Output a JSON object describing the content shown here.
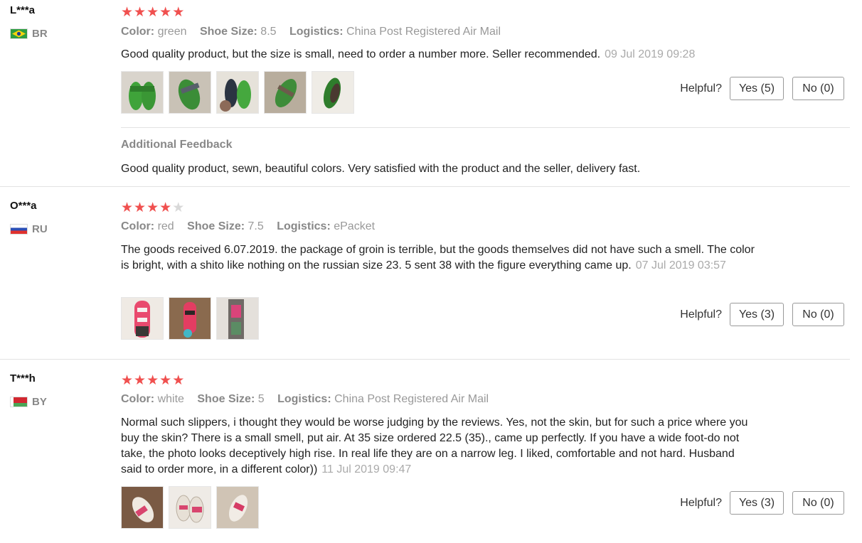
{
  "reviews": [
    {
      "user": "L***a",
      "country": "BR",
      "stars": [
        "★",
        "★",
        "★",
        "★",
        "★"
      ],
      "attrs": [
        {
          "label": "Color:",
          "value": "green"
        },
        {
          "label": "Shoe Size:",
          "value": "8.5"
        },
        {
          "label": "Logistics:",
          "value": "China Post Registered Air Mail"
        }
      ],
      "text": "Good quality product, but the size is small, need to order a number more. Seller recommended.",
      "date": "09 Jul 2019 09:28",
      "helpful_label": "Helpful?",
      "yes_label": "Yes (5)",
      "no_label": "No (0)",
      "additional_title": "Additional Feedback",
      "additional_text": "Good quality product, sewn, beautiful colors. Very satisfied with the product and the seller, delivery fast."
    },
    {
      "user": "O***a",
      "country": "RU",
      "stars": [
        "★",
        "★",
        "★",
        "★",
        "★"
      ],
      "attrs": [
        {
          "label": "Color:",
          "value": "red"
        },
        {
          "label": "Shoe Size:",
          "value": "7.5"
        },
        {
          "label": "Logistics:",
          "value": "ePacket"
        }
      ],
      "text": "The goods received 6.07.2019. the package of groin is terrible, but the goods themselves did not have such a smell. The color is bright, with a shito like nothing on the russian size 23. 5 sent 38 with the figure everything came up.",
      "date": "07 Jul 2019 03:57",
      "helpful_label": "Helpful?",
      "yes_label": "Yes (3)",
      "no_label": "No (0)"
    },
    {
      "user": "T***h",
      "country": "BY",
      "stars": [
        "★",
        "★",
        "★",
        "★",
        "★"
      ],
      "attrs": [
        {
          "label": "Color:",
          "value": "white"
        },
        {
          "label": "Shoe Size:",
          "value": "5"
        },
        {
          "label": "Logistics:",
          "value": "China Post Registered Air Mail"
        }
      ],
      "text": "Normal such slippers, i thought they would be worse judging by the reviews. Yes, not the skin, but for such a price where you buy the skin? There is a small smell, put air. At 35 size ordered 22.5 (35)., came up perfectly. If you have a wide foot-do not take, the photo looks deceptively high rise. In real life they are on a narrow leg. I liked, comfortable and not hard. Husband said to order more, in a different color))",
      "date": "11 Jul 2019 09:47",
      "helpful_label": "Helpful?",
      "yes_label": "Yes (3)",
      "no_label": "No (0)"
    }
  ],
  "ratings": [
    5,
    4,
    5
  ],
  "colors": {
    "star_active": "#f0504f",
    "star_inactive": "#d8d8d8",
    "date": "#aaaaaa",
    "attr_label": "#888888"
  },
  "icons": [
    "flag-br-icon",
    "flag-ru-icon",
    "flag-by-icon",
    "star-icon"
  ]
}
